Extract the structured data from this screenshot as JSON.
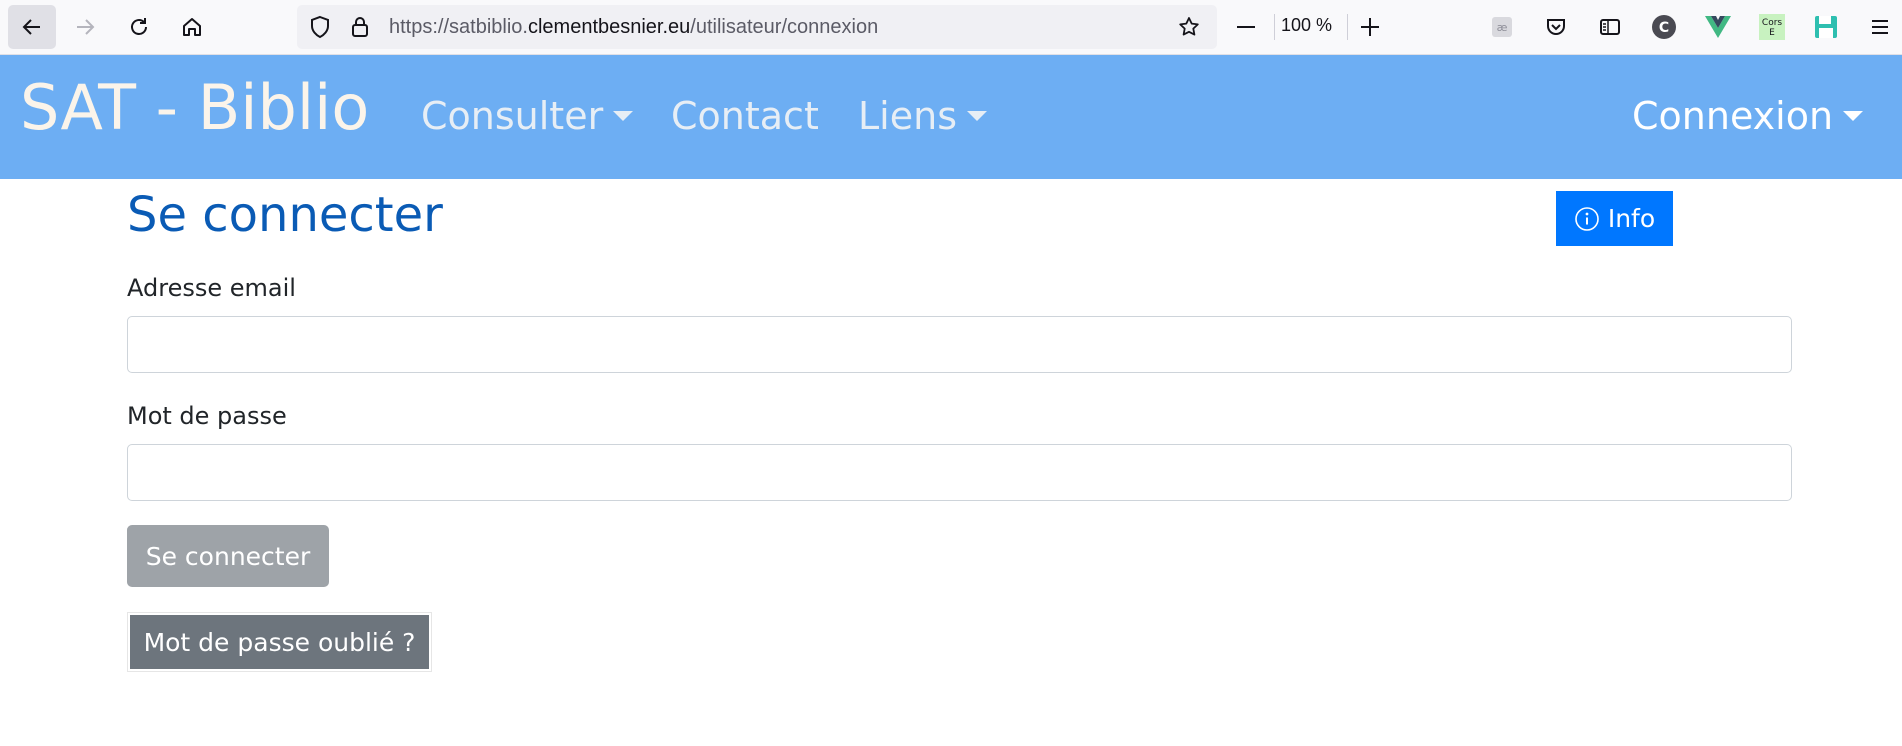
{
  "browser": {
    "url_prefix": "https://satbiblio.",
    "url_domain": "clementbesnier.eu",
    "url_path": "/utilisateur/connexion",
    "zoom": "100 %",
    "extensions": [
      "ae-icon",
      "pocket-icon",
      "reader-icon",
      "c-extension-icon",
      "vue-devtools-icon",
      "cors-extension-icon",
      "save-icon",
      "menu-icon"
    ],
    "ext_c_label": "C",
    "ext_cors_label": "Cors\nE"
  },
  "navbar": {
    "brand": "SAT - Biblio",
    "items": [
      {
        "label": "Consulter",
        "dropdown": true
      },
      {
        "label": "Contact",
        "dropdown": false
      },
      {
        "label": "Liens",
        "dropdown": true
      }
    ],
    "right": {
      "label": "Connexion",
      "dropdown": true
    },
    "color": "#6daef3"
  },
  "main": {
    "title": "Se connecter",
    "info_button": "Info",
    "email_label": "Adresse email",
    "email_value": "",
    "password_label": "Mot de passe",
    "password_value": "",
    "submit_label": "Se connecter",
    "forgot_label": "Mot de passe oublié ?"
  },
  "colors": {
    "title": "#0a5bb5",
    "info": "#0077ff",
    "submit_disabled": "#9ea3a8",
    "secondary": "#6d757d"
  }
}
